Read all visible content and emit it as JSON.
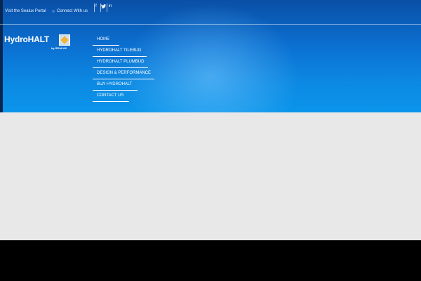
{
  "topbar": {
    "portal_link": "Visit the Sealux Portal",
    "connect_link": "Connect With us",
    "social": [
      "f",
      "t",
      "in"
    ]
  },
  "logo": {
    "name": "HydroHALT",
    "byline": "by SEALUX",
    "accent": "#f2b233"
  },
  "nav": {
    "items": [
      {
        "label": "HOME"
      },
      {
        "label": "HYDROHALT TILEBUD"
      },
      {
        "label": "HYDROHALT PLUMBUD"
      },
      {
        "label": "DESIGN & PERFORMANCE",
        "dropdown": true
      },
      {
        "label": "BUY HYDROHALT"
      },
      {
        "label": "CONTACT US"
      }
    ]
  },
  "colors": {
    "header_top": "#0a4fa6",
    "header_bottom": "#0b95ea",
    "content_bg": "#e8e8e8",
    "footer_bg": "#000000"
  }
}
